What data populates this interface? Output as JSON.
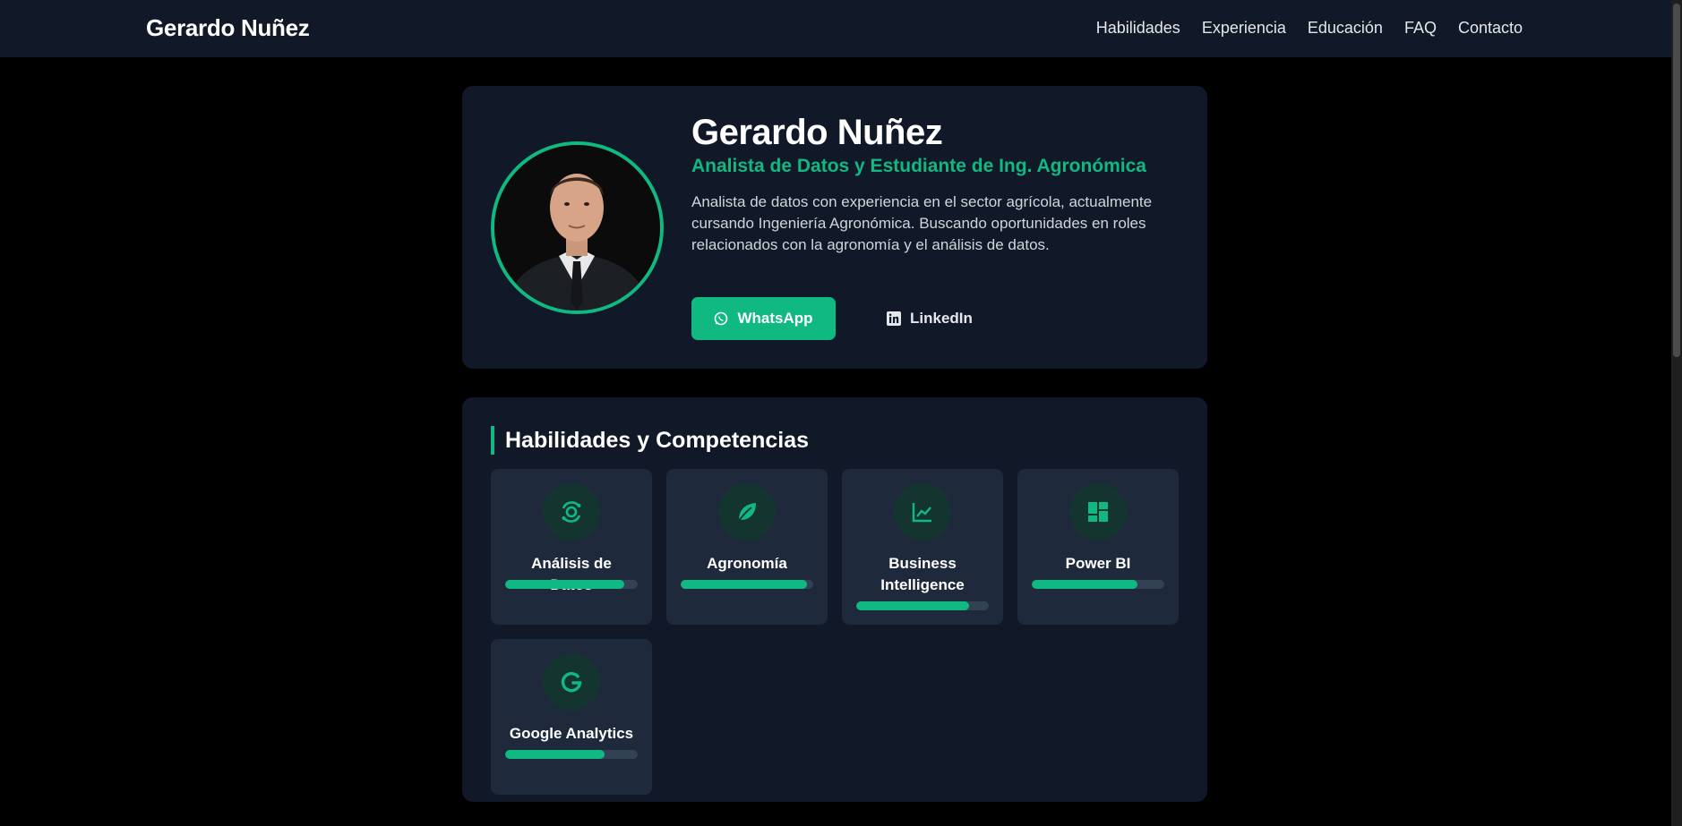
{
  "header": {
    "brand": "Gerardo Nuñez",
    "nav": [
      "Habilidades",
      "Experiencia",
      "Educación",
      "FAQ",
      "Contacto"
    ]
  },
  "hero": {
    "name": "Gerardo Nuñez",
    "role": "Analista de Datos y Estudiante de Ing. Agronómica",
    "description": "Analista de datos con experiencia en el sector agrícola, actualmente cursando Ingeniería Agronómica. Buscando oportunidades en roles relacionados con la agronomía y el análisis de datos.",
    "whatsapp_label": "WhatsApp",
    "linkedin_label": "LinkedIn",
    "avatar_icon": "profile-photo"
  },
  "skills": {
    "title": "Habilidades y Competencias",
    "items": [
      {
        "label": "Análisis de Datos",
        "icon": "data-analysis-icon",
        "level": 0.9
      },
      {
        "label": "Agronomía",
        "icon": "leaf-icon",
        "level": 0.95
      },
      {
        "label": "Business Intelligence",
        "icon": "chart-line-icon",
        "level": 0.85
      },
      {
        "label": "Power BI",
        "icon": "dashboard-icon",
        "level": 0.8
      },
      {
        "label": "Google Analytics",
        "icon": "google-icon",
        "level": 0.75
      }
    ]
  },
  "colors": {
    "accent": "#10b981",
    "card_bg": "#111827",
    "skill_bg": "#1e293b",
    "page_bg": "#000000"
  }
}
